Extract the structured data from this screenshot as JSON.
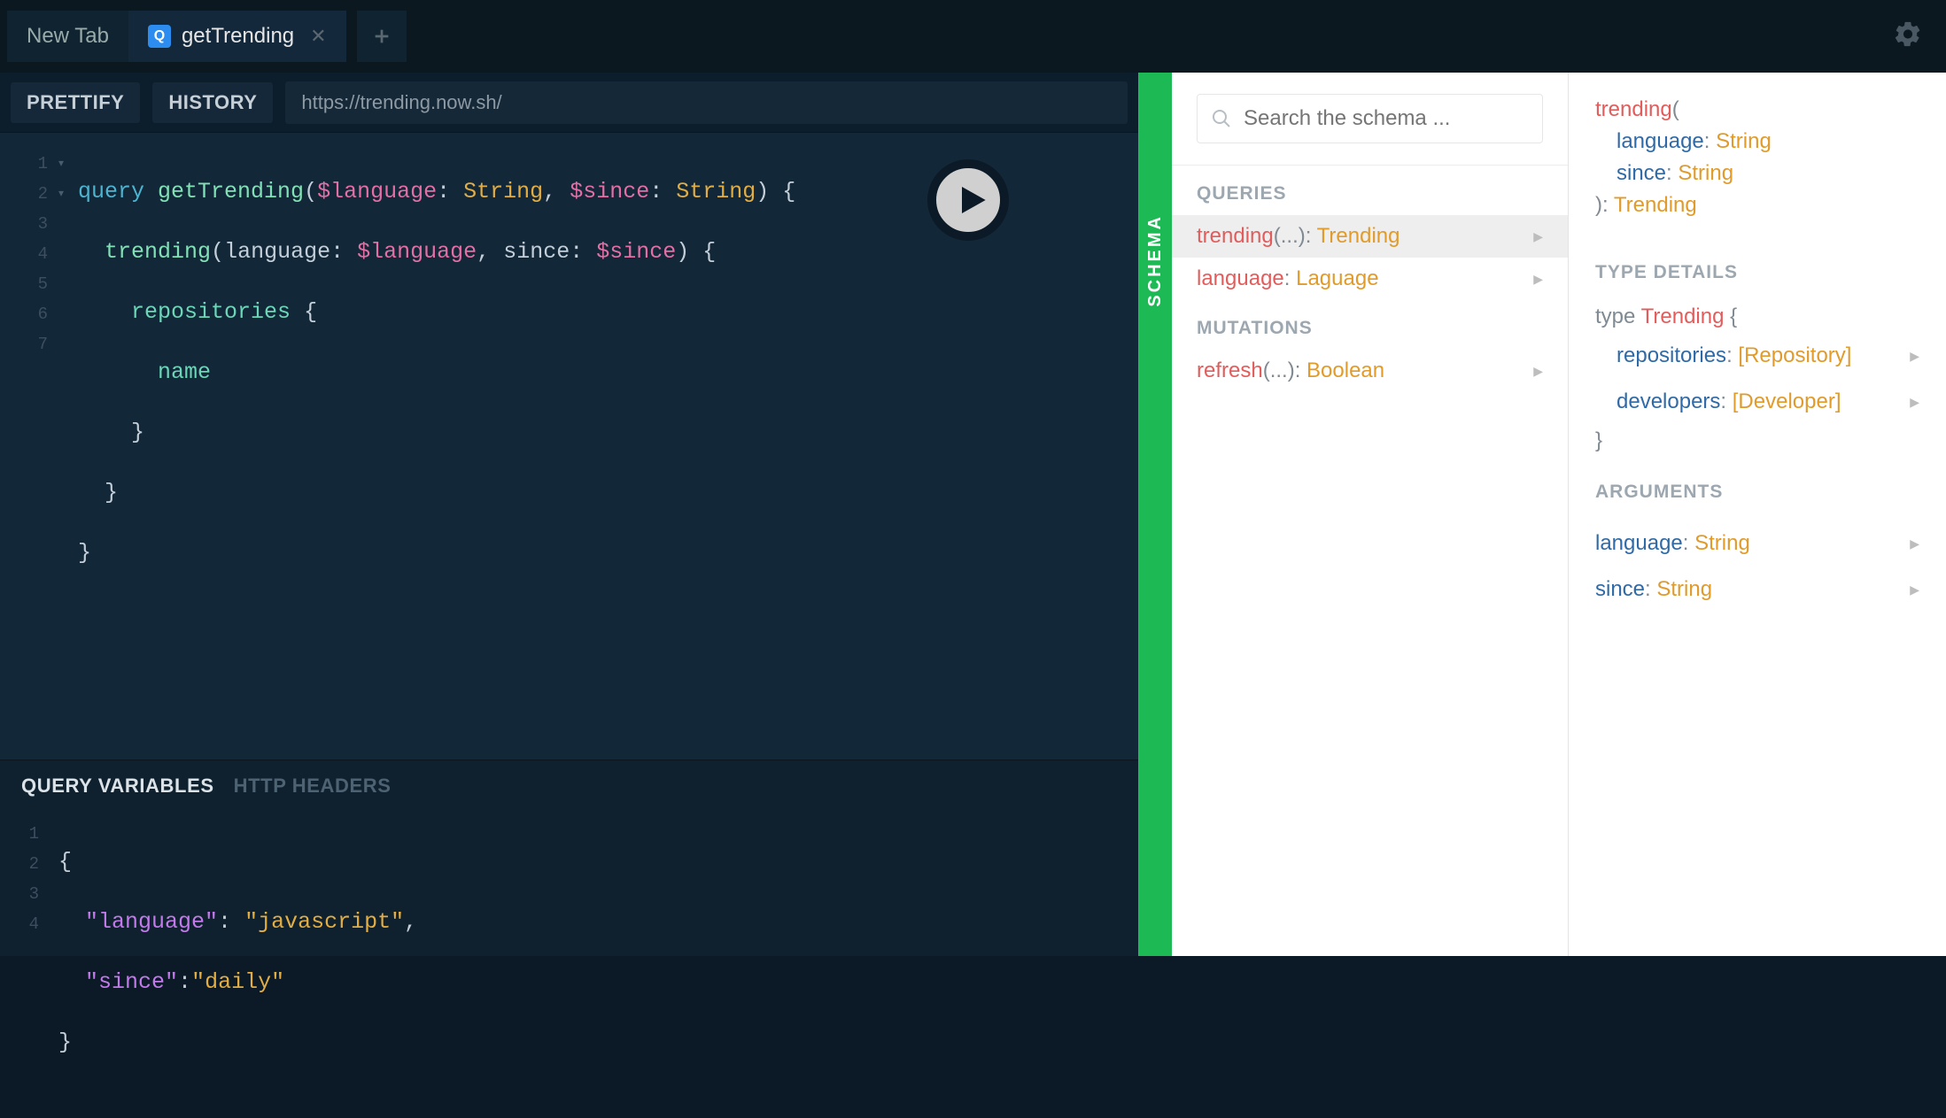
{
  "tabs": {
    "blank_label": "New Tab",
    "active_label": "getTrending",
    "badge_letter": "Q"
  },
  "toolbar": {
    "prettify": "PRETTIFY",
    "history": "HISTORY",
    "endpoint": "https://trending.now.sh/"
  },
  "query": {
    "lines": [
      "1",
      "2",
      "3",
      "4",
      "5",
      "6",
      "7"
    ],
    "text": {
      "l1_kw": "query",
      "l1_fn": "getTrending",
      "l1_var1": "$language",
      "l1_type1": "String",
      "l1_var2": "$since",
      "l1_type2": "String",
      "l2_fn": "trending",
      "l2_arg1": "language",
      "l2_val1": "$language",
      "l2_arg2": "since",
      "l2_val2": "$since",
      "l3_field": "repositories",
      "l4_field": "name",
      "brace_open": "{",
      "brace_close": "}",
      "paren_open": "(",
      "paren_close": ")",
      "colon": ":",
      "comma": ","
    }
  },
  "vars": {
    "tab_vars": "QUERY VARIABLES",
    "tab_headers": "HTTP HEADERS",
    "lines": [
      "1",
      "2",
      "3",
      "4"
    ],
    "json": {
      "open": "{",
      "close": "}",
      "k1": "\"language\"",
      "v1": "\"javascript\"",
      "k2": "\"since\"",
      "v2": "\"daily\"",
      "colon": ":",
      "comma": ","
    }
  },
  "schema": {
    "handle": "SCHEMA",
    "search_placeholder": "Search the schema ...",
    "left": {
      "queries_title": "QUERIES",
      "mutations_title": "MUTATIONS",
      "q_trending_name": "trending",
      "q_trending_args": "(...)",
      "q_trending_type": "Trending",
      "q_language_name": "language",
      "q_language_type": "Laguage",
      "m_refresh_name": "refresh",
      "m_refresh_args": "(...)",
      "m_refresh_type": "Boolean",
      "colon": ": "
    },
    "right": {
      "sig_name": "trending",
      "sig_open": "(",
      "sig_close": ")",
      "sig_arg1_name": "language",
      "sig_arg1_type": "String",
      "sig_arg2_name": "since",
      "sig_arg2_type": "String",
      "sig_return": "Trending",
      "colon": ": ",
      "type_details_title": "TYPE DETAILS",
      "type_kw": "type",
      "type_name": "Trending",
      "field1_name": "repositories",
      "field1_type": "[Repository]",
      "field2_name": "developers",
      "field2_type": "[Developer]",
      "brace_open": "{",
      "brace_close": "}",
      "args_title": "ARGUMENTS",
      "arg1_name": "language",
      "arg1_type": "String",
      "arg2_name": "since",
      "arg2_type": "String"
    }
  }
}
